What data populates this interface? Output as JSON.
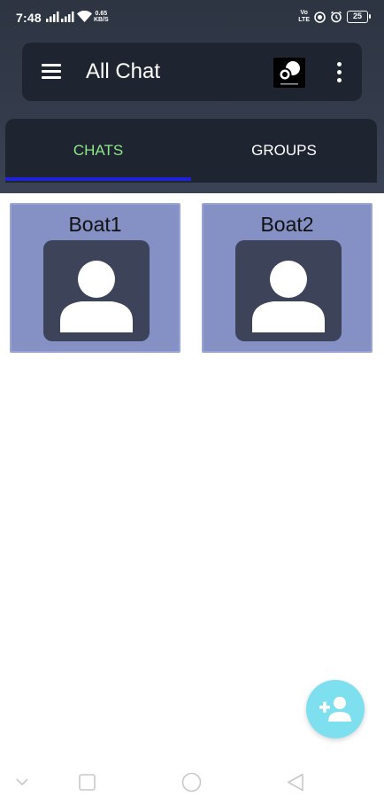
{
  "status_bar": {
    "time": "7:48",
    "speed_value": "0.65",
    "speed_unit": "KB/S",
    "volte_line1": "Vo",
    "volte_line2": "LTE",
    "battery": "25"
  },
  "app_bar": {
    "title": "All Chat",
    "menu_icon": "hamburger-icon",
    "logo_icon": "app-logo",
    "more_icon": "more-vertical-icon"
  },
  "tabs": [
    {
      "label": "CHATS",
      "selected": true
    },
    {
      "label": "GROUPS",
      "selected": false
    }
  ],
  "chats": [
    {
      "name": "Boat1",
      "avatar_icon": "default-person-icon"
    },
    {
      "name": "Boat2",
      "avatar_icon": "default-person-icon"
    }
  ],
  "fab": {
    "icon": "add-person-icon"
  },
  "colors": {
    "header_bg": "#2d3442",
    "bar_bg": "#1f2530",
    "tab_active_text": "#8ee68a",
    "tab_indicator": "#1f22d8",
    "card_bg": "#8591c4",
    "avatar_bg": "#3d4459",
    "fab_bg": "#7ee0ef"
  },
  "nav_bar": [
    "chevron-down-icon",
    "recents-square-icon",
    "home-circle-icon",
    "back-triangle-icon"
  ]
}
